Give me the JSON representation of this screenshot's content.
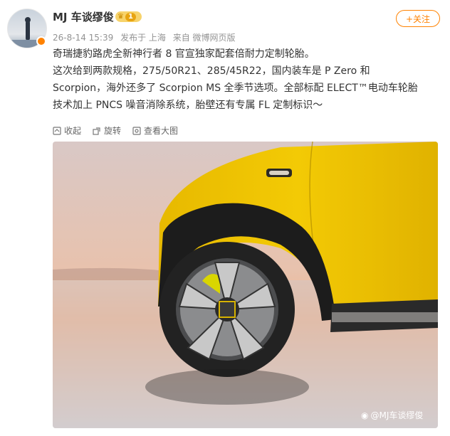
{
  "user": {
    "name": "MJ 车谈缪俊",
    "level": "1"
  },
  "post": {
    "meta": [
      "26-8-14 15:39",
      "发布于 上海",
      "来自 微博网页版"
    ],
    "follow_label": "+关注",
    "lines": [
      "奇瑞捷豹路虎全新神行者 8 官宣独家配套倍耐力定制轮胎。",
      "这次给到两款规格，275/50R21、285/45R22，国内装车是 P Zero 和",
      "Scorpion，海外还多了 Scorpion MS 全季节选项。全部标配 ELECT™电动车轮胎",
      "技术加上 PNCS 噪音消除系统，胎壁还有专属 FL 定制标识～"
    ]
  },
  "actions": [
    {
      "label": "收起",
      "icon": "collapse-icon"
    },
    {
      "label": "旋转",
      "icon": "rotate-icon"
    },
    {
      "label": "查看大图",
      "icon": "view-large-icon"
    }
  ],
  "image": {
    "watermark": "@MJ车谈缪俊",
    "car_color": "#f2c200",
    "sky_top": "#e7c7be",
    "sky_bottom": "#f0b28f"
  }
}
